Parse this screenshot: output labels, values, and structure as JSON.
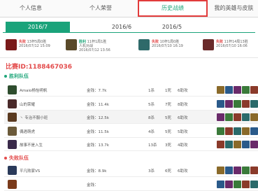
{
  "tabs": [
    {
      "label": "个人信息",
      "active": false
    },
    {
      "label": "个人荣誉",
      "active": false
    },
    {
      "label": "历史战绩",
      "active": true
    },
    {
      "label": "我的英雄与皮肤",
      "active": false
    }
  ],
  "dates": [
    {
      "label": "2016/7",
      "active": true
    },
    {
      "label": "2016/6",
      "active": false
    },
    {
      "label": "2016/5",
      "active": false
    }
  ],
  "recent_games": [
    {
      "result": "失败",
      "line1": "13杯5局0胜",
      "line2": "2016/07/12 15:09",
      "result_type": "lose",
      "icon_color": "#7a1a1a"
    },
    {
      "result": "胜利",
      "line1": "11杯1局1胜",
      "mode": "人机对战",
      "line2": "2016/07/12 13:56",
      "result_type": "win",
      "icon_color": "#5a4a2a"
    },
    {
      "result": "失败",
      "line1": "10杯1局0胜",
      "line2": "2016/07/10 16:19",
      "result_type": "lose",
      "icon_color": "#2f6a6a"
    },
    {
      "result": "失败",
      "line1": "11杯14局13胜",
      "line2": "2016/07/10 16:06",
      "result_type": "lose",
      "icon_color": "#6a2a2a"
    }
  ],
  "match_id": "比赛ID:1188467036",
  "winning_team": {
    "title": "胜利队伍",
    "players": [
      {
        "name": "Amaio杨怡明帆",
        "gold_label": "金钱：7.7k",
        "kills": "1杀",
        "deaths": "1死",
        "assists": "6助攻",
        "avatar_color": "#2e4d2e"
      },
      {
        "name": "山的荣耀",
        "gold_label": "金钱：11.4k",
        "kills": "5杀",
        "deaths": "7死",
        "assists": "8助攻",
        "avatar_color": "#4a2a2a"
      },
      {
        "name": "丶 专治不服小班",
        "gold_label": "金钱：12.5k",
        "kills": "8杀",
        "deaths": "5死",
        "assists": "6助攻",
        "avatar_color": "#5a3a20"
      },
      {
        "name": "偶遇萌虎",
        "gold_label": "金钱：11.5k",
        "kills": "4杀",
        "deaths": "5死",
        "assists": "5助攻",
        "avatar_color": "#6b5a3a"
      },
      {
        "name": "故事不是入生",
        "gold_label": "金钱：13.7k",
        "kills": "13杀",
        "deaths": "3死",
        "assists": "4助攻",
        "avatar_color": "#3a2a4a"
      }
    ]
  },
  "losing_team": {
    "title": "失败队伍",
    "players": [
      {
        "name": "平凡败家VS",
        "gold_label": "金钱：8.9k",
        "kills": "3杀",
        "deaths": "6死",
        "assists": "6助攻",
        "avatar_color": "#2a3a5a"
      },
      {
        "name": "",
        "gold_label": "金钱：",
        "kills": "",
        "deaths": "",
        "assists": "",
        "avatar_color": "#7a3a1a"
      }
    ]
  },
  "colors": {
    "accent": "#1aa37a",
    "lose": "#e34b4b",
    "win": "#1fa67a",
    "tab_highlight": "#e23b3b"
  }
}
